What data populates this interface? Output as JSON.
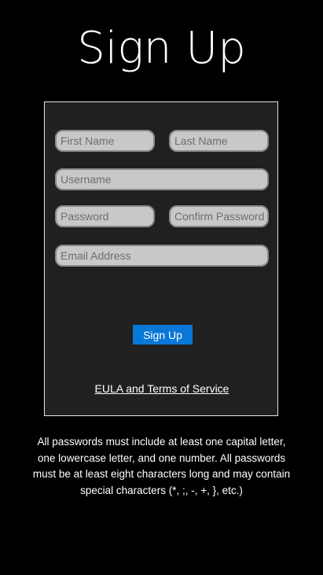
{
  "header": {
    "title": "Sign Up"
  },
  "form": {
    "first_name": {
      "placeholder": "First Name",
      "value": ""
    },
    "last_name": {
      "placeholder": "Last Name",
      "value": ""
    },
    "username": {
      "placeholder": "Username",
      "value": ""
    },
    "password": {
      "placeholder": "Password",
      "value": ""
    },
    "confirm_password": {
      "placeholder": "Confirm Password",
      "value": ""
    },
    "email": {
      "placeholder": "Email Address",
      "value": ""
    },
    "submit_label": "Sign Up",
    "eula_link": "EULA and Terms of Service"
  },
  "footer": {
    "password_note": "All passwords must include at least one capital letter, one lowercase letter, and one number. All passwords must be at least eight characters long and may contain special characters (*, ;, -, +, }, etc.)"
  },
  "colors": {
    "background": "#000000",
    "panel": "#202020",
    "field": "#c8c8c8",
    "accent": "#0a78d7"
  }
}
